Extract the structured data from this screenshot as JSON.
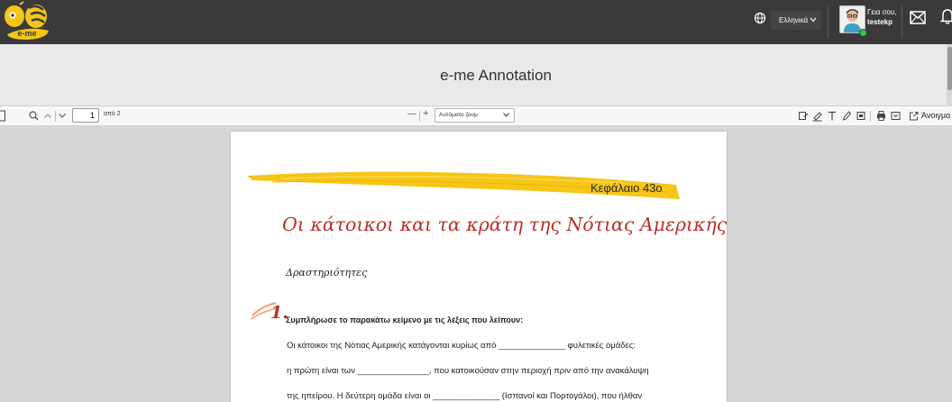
{
  "topbar": {
    "logo_text": "e-me",
    "language": "Ελληνικά",
    "greeting": "Γεια σου,",
    "username": "testekp"
  },
  "title_bar": {
    "title": "e-me Annotation"
  },
  "pdf_toolbar": {
    "page_number": "1",
    "page_of": "από 2",
    "zoom_value": "Αυτόματο ζουμ",
    "zoom_minus": "—",
    "zoom_plus": "+",
    "open_label": "Άνοιγμα"
  },
  "document": {
    "chapter": "Κεφάλαιο 43ο",
    "chapter_title": "Οι κάτοικοι και τα κράτη της Νότιας Αμερικής",
    "activities_heading": "Δραστηριότητες",
    "exercise_number": "1.",
    "exercise_instruction": "Συμπλήρωσε το παρακάτω κείμενο με τις λέξεις που λείπουν:",
    "lines": [
      "Οι κάτοικοι της Νότιας Αμερικής κατάγονται κυρίως από ______________ φυλετικές ομάδες:",
      "η πρώτη είναι των _______________, που κατοικούσαν στην περιοχή πριν από την ανακάλυψη",
      "της ηπείρου. Η δεύτερη ομάδα είναι οι ______________ (Ισπανοί και Πορτογάλοι), που ήλθαν"
    ]
  },
  "colors": {
    "topbar_bg": "#3a3a3a",
    "accent_red": "#b8322a",
    "banner_yellow": "#f5c518"
  }
}
